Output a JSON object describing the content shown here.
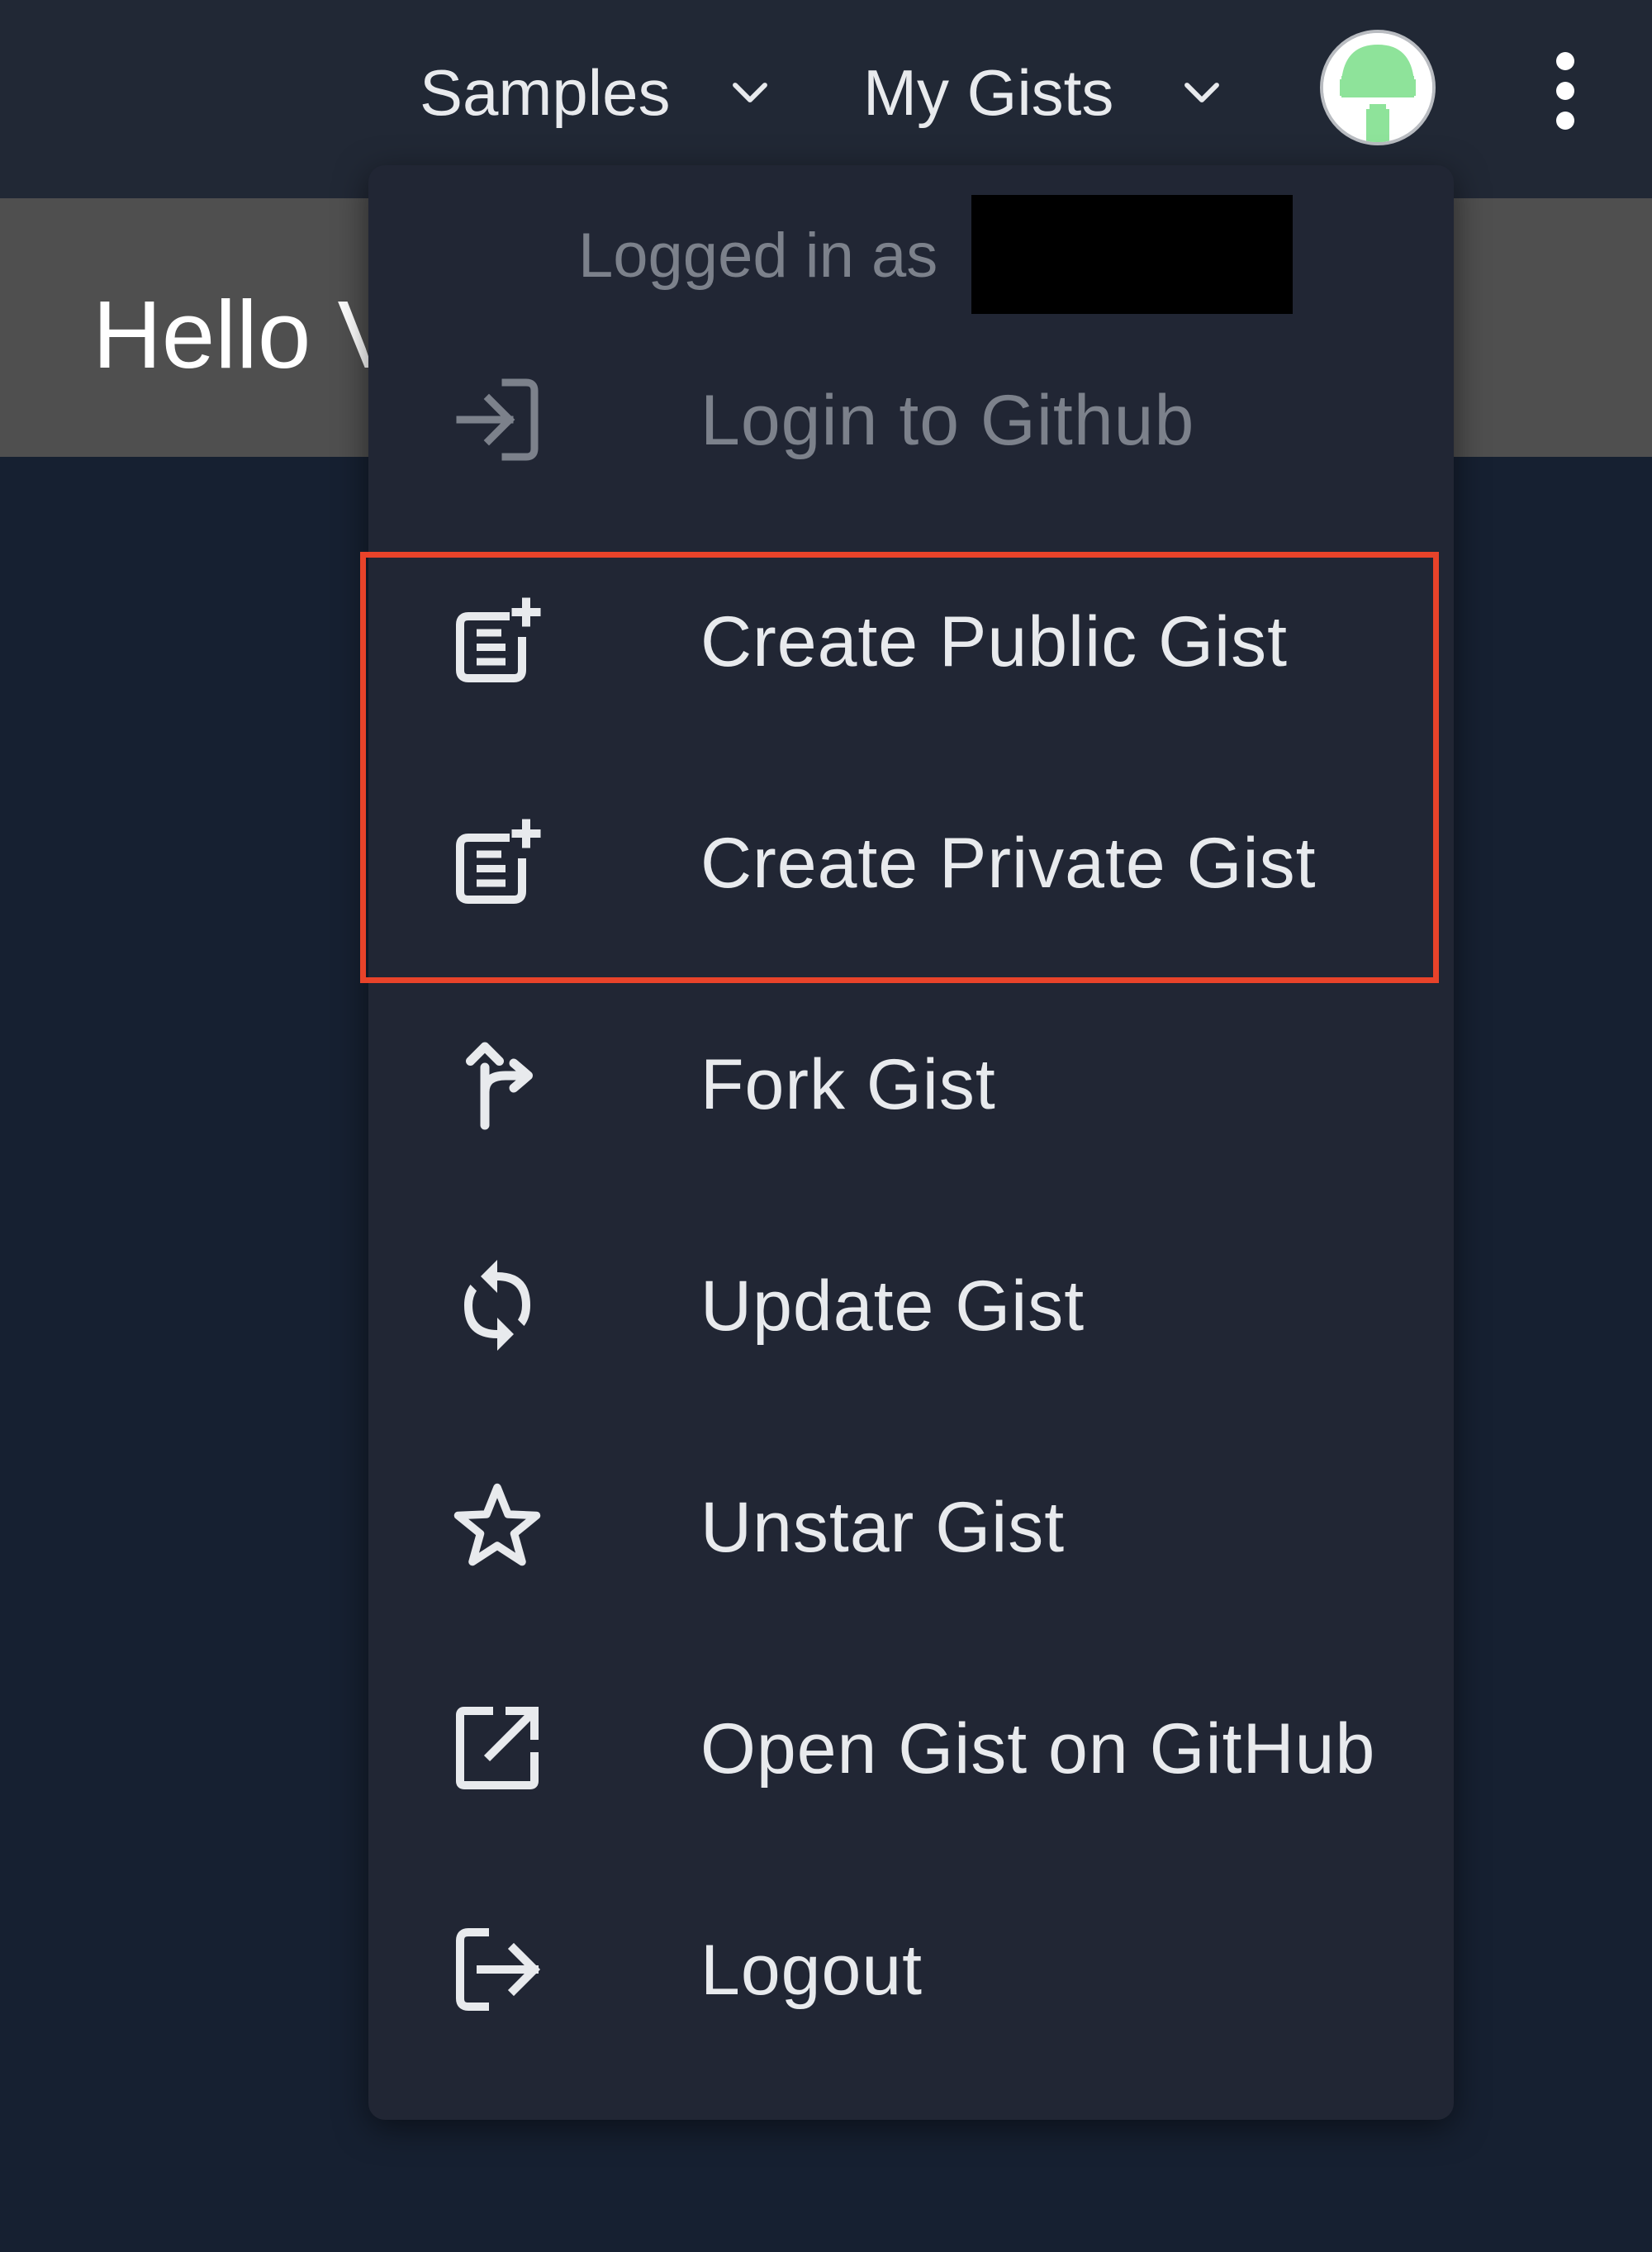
{
  "topbar": {
    "samples_label": "Samples",
    "my_gists_label": "My Gists",
    "avatar_icon": "user-avatar",
    "more_icon": "more-vert-icon"
  },
  "editor": {
    "title": "Hello V"
  },
  "menu": {
    "logged_in_label": "Logged in as",
    "items": [
      {
        "label": "Login to Github",
        "icon": "login-icon",
        "disabled": true
      },
      {
        "label": "Create Public Gist",
        "icon": "post-add-icon",
        "disabled": false
      },
      {
        "label": "Create Private Gist",
        "icon": "post-add-icon",
        "disabled": false
      },
      {
        "label": "Fork Gist",
        "icon": "fork-icon",
        "disabled": false
      },
      {
        "label": "Update Gist",
        "icon": "sync-icon",
        "disabled": false
      },
      {
        "label": "Unstar Gist",
        "icon": "star-outline-icon",
        "disabled": false
      },
      {
        "label": "Open Gist on GitHub",
        "icon": "open-in-new-icon",
        "disabled": false
      },
      {
        "label": "Logout",
        "icon": "logout-icon",
        "disabled": false
      }
    ]
  },
  "colors": {
    "background": "#162031",
    "topbar": "#212835",
    "titlebar": "#4f4f4f",
    "menu": "#212634",
    "highlight": "#e8432a",
    "avatar_green": "#8ee39a",
    "avatar_stem": "#3fbf5f"
  }
}
